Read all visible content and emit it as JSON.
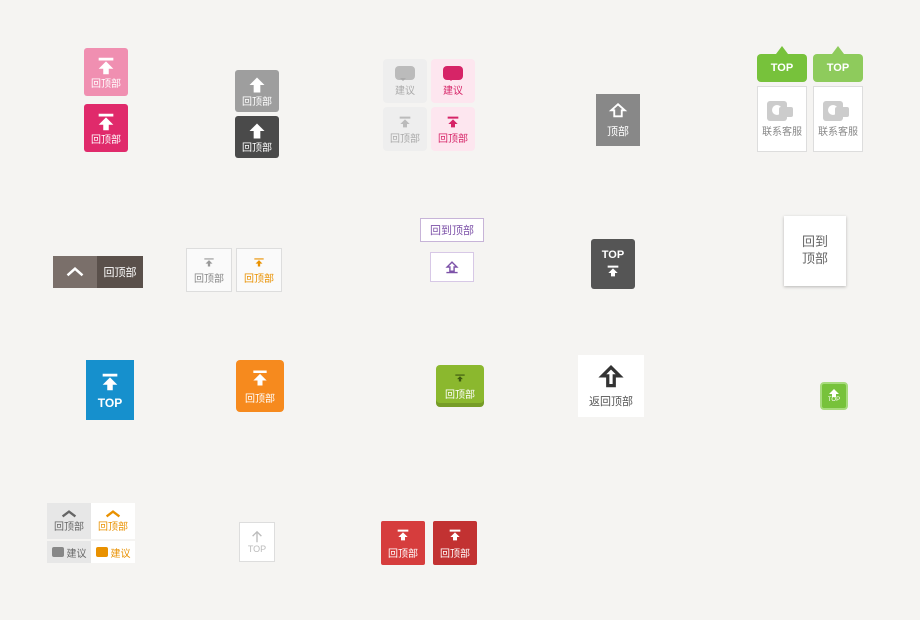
{
  "labels": {
    "backTop": "回顶部",
    "backTopFull": "回到顶部",
    "backTopShort": "回到\n顶部",
    "top": "顶部",
    "topEn": "TOP",
    "suggest": "建议",
    "contact": "联系客服",
    "returnTop": "返回顶部"
  }
}
